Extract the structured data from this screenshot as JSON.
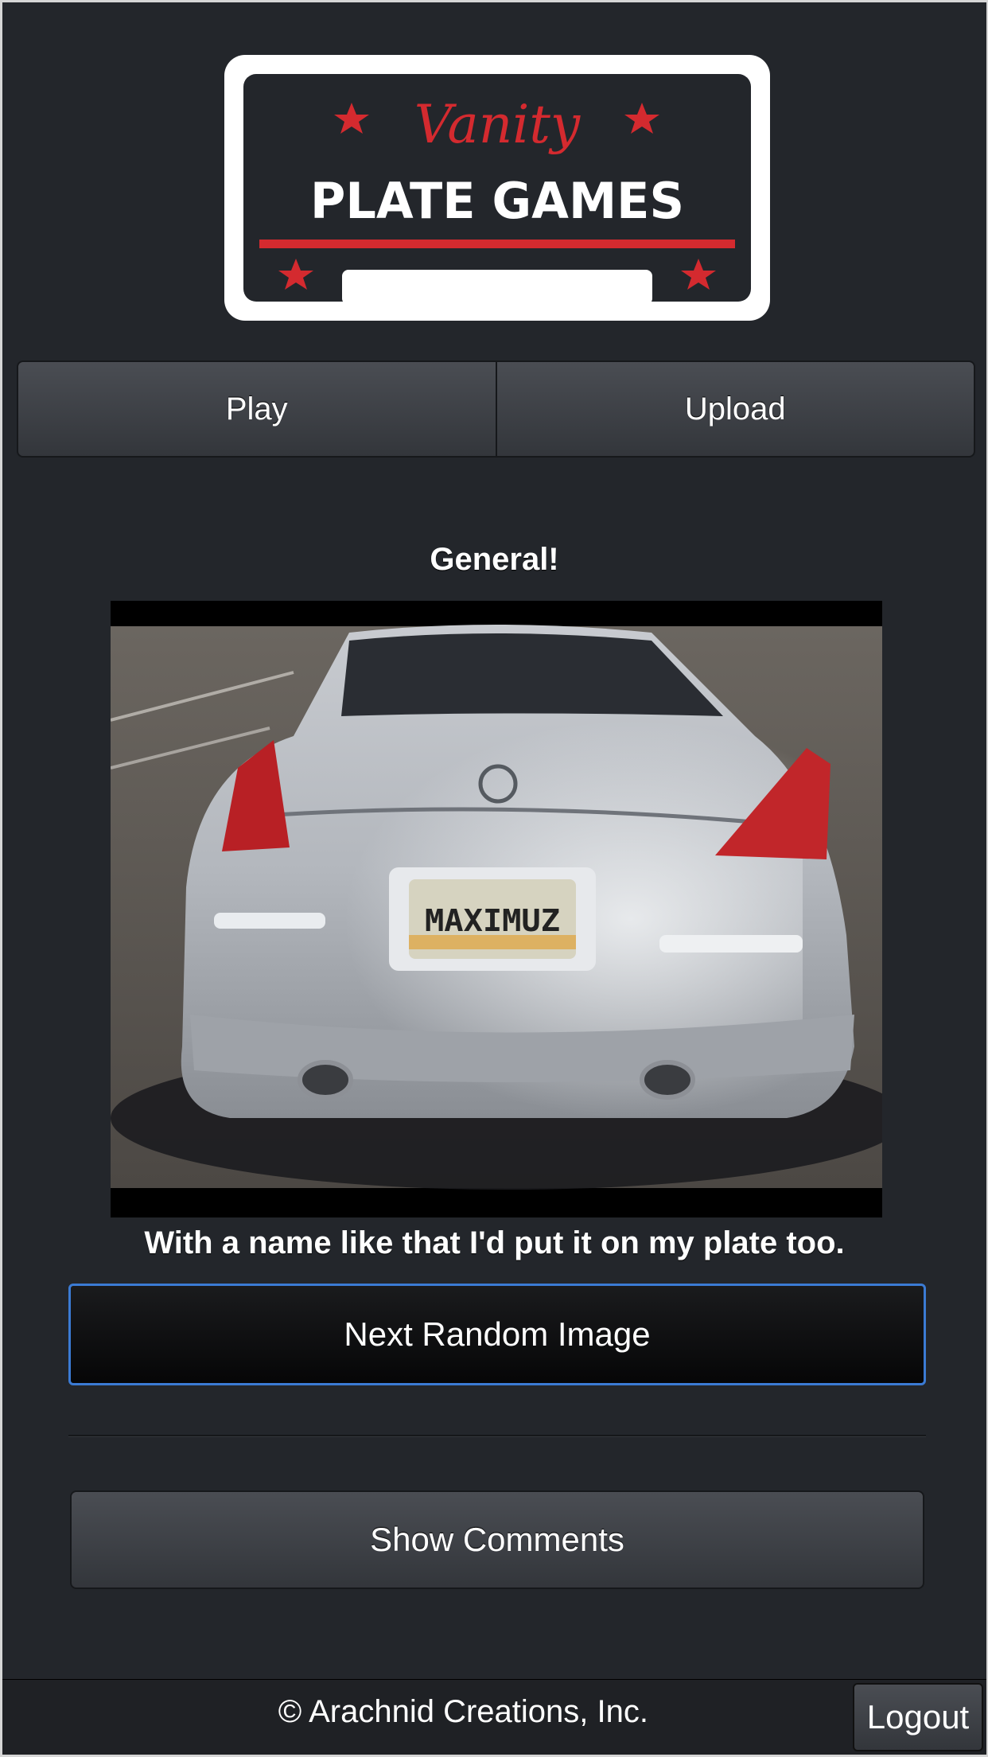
{
  "logo": {
    "script_text": "Vanity",
    "main_text": "PLATE GAMES",
    "colors": {
      "frame": "#ffffff",
      "plate": "#23262b",
      "accent": "#d42a2f"
    }
  },
  "nav": {
    "items": [
      {
        "label": "Play"
      },
      {
        "label": "Upload"
      }
    ]
  },
  "post": {
    "category": "General!",
    "plate_text": "MAXIMUZ",
    "caption": "With a name like that I'd put it on my plate too."
  },
  "actions": {
    "next_label": "Next Random Image",
    "comments_label": "Show Comments"
  },
  "footer": {
    "copyright": "© Arachnid Creations, Inc.",
    "logout_label": "Logout"
  },
  "theme": {
    "background": "#23262b",
    "focus_border": "#3b7bd4"
  }
}
